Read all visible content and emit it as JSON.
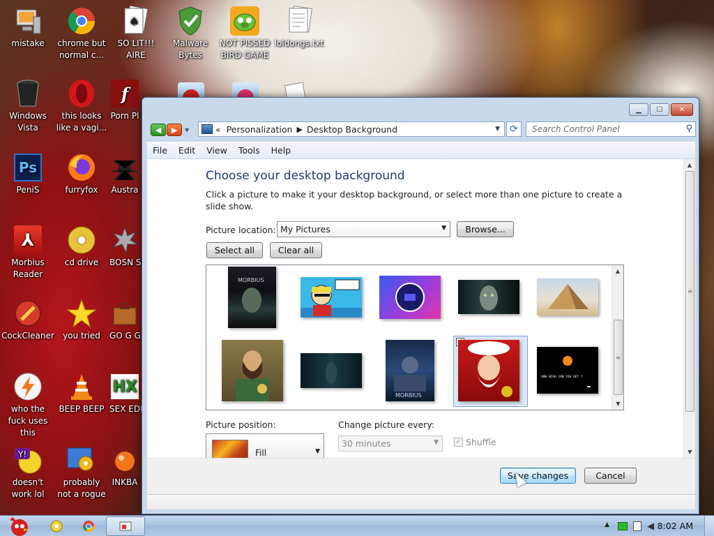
{
  "desktop": {
    "icons": [
      {
        "label": "mistake",
        "icon": "computer-icon"
      },
      {
        "label": "chrome but normal c...",
        "icon": "chrome-icon"
      },
      {
        "label": "SO LIT!!! AIRE",
        "icon": "solitaire-icon"
      },
      {
        "label": "Malware Bytes",
        "icon": "shield-icon"
      },
      {
        "label": "NOT PISSED BIRD GAME",
        "icon": "bird-game-icon"
      },
      {
        "label": "loldongs.txt",
        "icon": "text-file-icon"
      },
      {
        "label": "Windows Vista",
        "icon": "recycle-bin-icon"
      },
      {
        "label": "this looks like a vagi...",
        "icon": "opera-icon"
      },
      {
        "label": "Porn Pl",
        "icon": "flash-icon"
      },
      {
        "label": "PeniS",
        "icon": "photoshop-icon"
      },
      {
        "label": "furryfox",
        "icon": "firefox-icon"
      },
      {
        "label": "Austra",
        "icon": "spider-solitaire-icon"
      },
      {
        "label": "Morbius Reader",
        "icon": "pdf-reader-icon"
      },
      {
        "label": "cd drive",
        "icon": "cd-icon"
      },
      {
        "label": "BOSN SIMULA",
        "icon": "spiky-icon"
      },
      {
        "label": "CockCleaner",
        "icon": "ccleaner-icon"
      },
      {
        "label": "you tried",
        "icon": "star-icon"
      },
      {
        "label": "GO G GADGE",
        "icon": "briefcase-icon"
      },
      {
        "label": "who the fuck uses this",
        "icon": "winamp-icon"
      },
      {
        "label": "BEEP BEEP",
        "icon": "vlc-icon"
      },
      {
        "label": "SEX EDITIO",
        "icon": "hx-icon"
      },
      {
        "label": "doesn't work lol",
        "icon": "yahoo-icon"
      },
      {
        "label": "probably not a rogue",
        "icon": "gears-icon"
      },
      {
        "label": "INKBA",
        "icon": "inkball-icon"
      }
    ]
  },
  "window": {
    "breadcrumb": [
      "Personalization",
      "Desktop Background"
    ],
    "breadcrumb_prefix": "«",
    "search_placeholder": "Search Control Panel",
    "menu": [
      "File",
      "Edit",
      "View",
      "Tools",
      "Help"
    ],
    "heading": "Choose your desktop background",
    "description": "Click a picture to make it your desktop background, or select more than one picture to create a slide show.",
    "picture_location_label": "Picture location:",
    "picture_location_value": "My Pictures",
    "browse_label": "Browse...",
    "select_all_label": "Select all",
    "clear_all_label": "Clear all",
    "thumbnails": [
      {
        "name": "morbius-poster-1",
        "selected": false
      },
      {
        "name": "cartoon-man",
        "selected": false
      },
      {
        "name": "purple-logo",
        "selected": false
      },
      {
        "name": "morbius-face",
        "selected": false
      },
      {
        "name": "pyramid",
        "selected": false
      },
      {
        "name": "painted-portrait",
        "selected": false
      },
      {
        "name": "dark-scene",
        "selected": false
      },
      {
        "name": "morbius-poster-2",
        "selected": false
      },
      {
        "name": "santa",
        "selected": true
      },
      {
        "name": "game-screen",
        "selected": false
      }
    ],
    "game_screen_text": "HOW HIGH CAN YOU GET ?",
    "picture_position_label": "Picture position:",
    "picture_position_value": "Fill",
    "change_every_label": "Change picture every:",
    "change_every_value": "30 minutes",
    "shuffle_label": "Shuffle",
    "shuffle_checked": true,
    "save_label": "Save changes",
    "cancel_label": "Cancel"
  },
  "taskbar": {
    "time": "8:02 AM"
  }
}
